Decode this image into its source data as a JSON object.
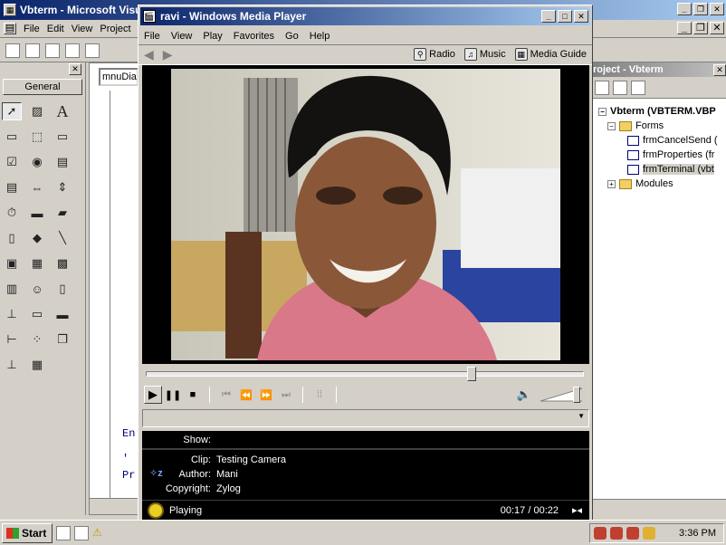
{
  "vb": {
    "title": "Vbterm - Microsoft Visu",
    "menu": [
      "File",
      "Edit",
      "View",
      "Project"
    ],
    "toolbox_tab": "General",
    "code_combo": "mnuDia",
    "code_lines": [
      "En",
      "'",
      "Pr"
    ],
    "project": {
      "title": "roject - Vbterm",
      "root": "Vbterm (VBTERM.VBP",
      "forms_label": "Forms",
      "forms": [
        "frmCancelSend (",
        "frmProperties (fr",
        "frmTerminal (vbt"
      ],
      "modules_label": "Modules"
    }
  },
  "wmp": {
    "title": "ravi - Windows Media Player",
    "menu": [
      "File",
      "View",
      "Play",
      "Favorites",
      "Go",
      "Help"
    ],
    "guides": [
      {
        "label": "Radio",
        "icon": "radio-icon"
      },
      {
        "label": "Music",
        "icon": "music-icon"
      },
      {
        "label": "Media Guide",
        "icon": "media-guide-icon"
      }
    ],
    "seek_fraction": 0.75,
    "volume_fraction": 0.95,
    "show_label": "Show:",
    "clip_label": "Clip:",
    "clip_value": "Testing Camera",
    "author_label": "Author:",
    "author_value": "Mani",
    "copyright_label": "Copyright:",
    "copyright_value": "Zylog",
    "status": "Playing",
    "time": "00:17 / 00:22"
  },
  "taskbar": {
    "start": "Start",
    "clock": "3:36 PM"
  },
  "colors": {
    "title_active": "#0a246a",
    "title_gradient_end": "#a6caf0",
    "face": "#d4d0c8"
  }
}
